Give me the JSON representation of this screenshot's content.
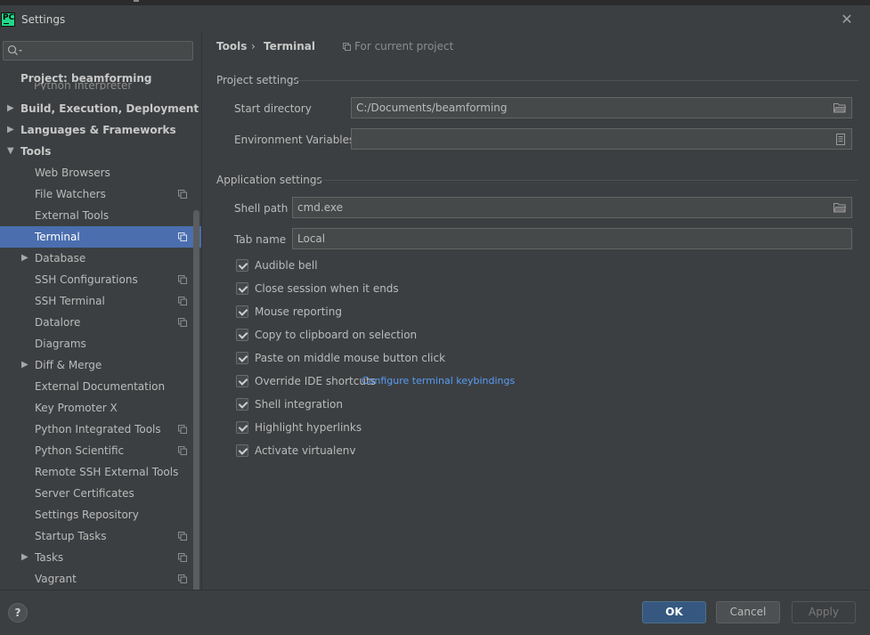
{
  "window": {
    "title": "Settings",
    "logo_text": "PC"
  },
  "search": {
    "placeholder": ""
  },
  "sidebar": {
    "project_header": "Project: beamforming",
    "partial_item": "Python Interpreter",
    "items": [
      {
        "label": "Build, Execution, Deployment",
        "level": 0,
        "bold": true,
        "arrow": "right"
      },
      {
        "label": "Languages & Frameworks",
        "level": 0,
        "bold": true,
        "arrow": "right"
      },
      {
        "label": "Tools",
        "level": 0,
        "bold": true,
        "arrow": "down"
      },
      {
        "label": "Web Browsers",
        "level": 1
      },
      {
        "label": "File Watchers",
        "level": 1,
        "copy": true
      },
      {
        "label": "External Tools",
        "level": 1
      },
      {
        "label": "Terminal",
        "level": 1,
        "copy": true,
        "selected": true
      },
      {
        "label": "Database",
        "level": 1,
        "arrow": "right"
      },
      {
        "label": "SSH Configurations",
        "level": 1,
        "copy": true
      },
      {
        "label": "SSH Terminal",
        "level": 1,
        "copy": true
      },
      {
        "label": "Datalore",
        "level": 1,
        "copy": true
      },
      {
        "label": "Diagrams",
        "level": 1
      },
      {
        "label": "Diff & Merge",
        "level": 1,
        "arrow": "right"
      },
      {
        "label": "External Documentation",
        "level": 1
      },
      {
        "label": "Key Promoter X",
        "level": 1
      },
      {
        "label": "Python Integrated Tools",
        "level": 1,
        "copy": true
      },
      {
        "label": "Python Scientific",
        "level": 1,
        "copy": true
      },
      {
        "label": "Remote SSH External Tools",
        "level": 1
      },
      {
        "label": "Server Certificates",
        "level": 1
      },
      {
        "label": "Settings Repository",
        "level": 1
      },
      {
        "label": "Startup Tasks",
        "level": 1,
        "copy": true
      },
      {
        "label": "Tasks",
        "level": 1,
        "arrow": "right",
        "copy": true
      },
      {
        "label": "Vagrant",
        "level": 1,
        "copy": true
      }
    ]
  },
  "breadcrumb": {
    "parent": "Tools",
    "separator": "›",
    "current": "Terminal",
    "scope": "For current project"
  },
  "project_settings": {
    "title": "Project settings",
    "start_directory_label": "Start directory",
    "start_directory_value": "C:/Documents/beamforming",
    "env_vars_label": "Environment Variables",
    "env_vars_value": ""
  },
  "application_settings": {
    "title": "Application settings",
    "shell_path_label": "Shell path",
    "shell_path_value": "cmd.exe",
    "tab_name_label": "Tab name",
    "tab_name_value": "Local",
    "checkboxes": [
      {
        "label": "Audible bell",
        "checked": true
      },
      {
        "label": "Close session when it ends",
        "checked": true
      },
      {
        "label": "Mouse reporting",
        "checked": true
      },
      {
        "label": "Copy to clipboard on selection",
        "checked": true
      },
      {
        "label": "Paste on middle mouse button click",
        "checked": true
      },
      {
        "label": "Override IDE shortcuts",
        "checked": true
      },
      {
        "label": "Shell integration",
        "checked": true
      },
      {
        "label": "Highlight hyperlinks",
        "checked": true
      },
      {
        "label": "Activate virtualenv",
        "checked": true
      }
    ],
    "keybindings_link": "Configure terminal keybindings"
  },
  "footer": {
    "help": "?",
    "ok": "OK",
    "cancel": "Cancel",
    "apply": "Apply"
  },
  "colors": {
    "background": "#3c3f41",
    "selection": "#4b6eaf",
    "link": "#589df6",
    "ok_button": "#365880"
  }
}
